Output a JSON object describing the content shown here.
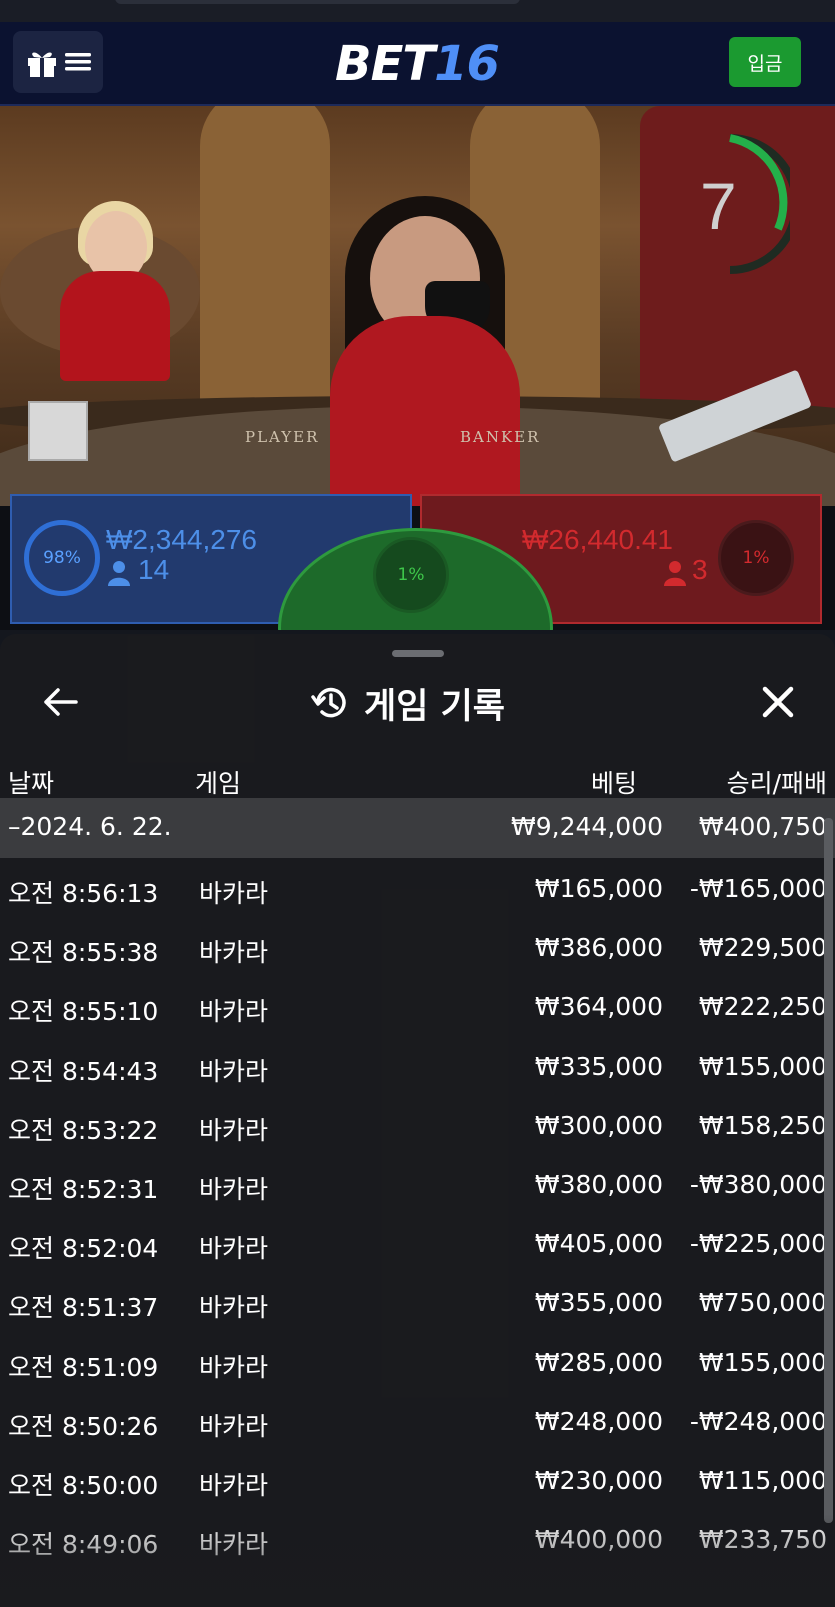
{
  "header": {
    "logo_main": "BET",
    "logo_num": "16",
    "deposit_label": "입금"
  },
  "video": {
    "timer": "7",
    "felt_player": "PLAYER",
    "felt_banker": "BANKER"
  },
  "bets": {
    "player": {
      "percent": "98%",
      "amount": "₩2,344,276",
      "players": "14"
    },
    "banker": {
      "percent": "1%",
      "amount": "₩26,440.41",
      "players": "3"
    },
    "tie": {
      "percent": "1%"
    }
  },
  "history": {
    "title": "게임 기록",
    "columns": {
      "date": "날짜",
      "game": "게임",
      "bet": "베팅",
      "result": "승리/패배"
    },
    "group": {
      "date": "–2024. 6. 22.",
      "bet": "₩9,244,000",
      "result": "₩400,750"
    },
    "rows": [
      {
        "time": "오전 8:56:13",
        "game": "바카라",
        "bet": "₩165,000",
        "result": "-₩165,000"
      },
      {
        "time": "오전 8:55:38",
        "game": "바카라",
        "bet": "₩386,000",
        "result": "₩229,500"
      },
      {
        "time": "오전 8:55:10",
        "game": "바카라",
        "bet": "₩364,000",
        "result": "₩222,250"
      },
      {
        "time": "오전 8:54:43",
        "game": "바카라",
        "bet": "₩335,000",
        "result": "₩155,000"
      },
      {
        "time": "오전 8:53:22",
        "game": "바카라",
        "bet": "₩300,000",
        "result": "₩158,250"
      },
      {
        "time": "오전 8:52:31",
        "game": "바카라",
        "bet": "₩380,000",
        "result": "-₩380,000"
      },
      {
        "time": "오전 8:52:04",
        "game": "바카라",
        "bet": "₩405,000",
        "result": "-₩225,000"
      },
      {
        "time": "오전 8:51:37",
        "game": "바카라",
        "bet": "₩355,000",
        "result": "₩750,000"
      },
      {
        "time": "오전 8:51:09",
        "game": "바카라",
        "bet": "₩285,000",
        "result": "₩155,000"
      },
      {
        "time": "오전 8:50:26",
        "game": "바카라",
        "bet": "₩248,000",
        "result": "-₩248,000"
      },
      {
        "time": "오전 8:50:00",
        "game": "바카라",
        "bet": "₩230,000",
        "result": "₩115,000"
      },
      {
        "time": "오전 8:49:06",
        "game": "바카라",
        "bet": "₩400,000",
        "result": "₩233,750"
      }
    ]
  },
  "icons": {
    "menu": "gift-menu-icon",
    "back": "arrow-left-icon",
    "history": "history-clock-icon",
    "close": "close-icon",
    "user": "user-icon"
  },
  "colors": {
    "header_bg": "#0b1230",
    "deposit": "#1b9a30",
    "player": "#2f5db0",
    "banker": "#b02a2e",
    "tie": "#1d6a2a",
    "sheet_bg": "#1a1b1e",
    "group_row": "#3b3c3f"
  }
}
